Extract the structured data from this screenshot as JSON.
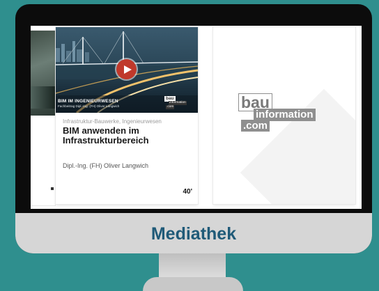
{
  "footer": {
    "title": "Mediathek"
  },
  "card": {
    "thumbnail": {
      "title": "BIM IM INGENIEURWESEN",
      "subtitle": "Fachbeitrag Dipl.-Ing. (FH) Oliver Langwich",
      "logo": {
        "line1": "bau",
        "line2": "information",
        "line3": ".com"
      },
      "play_icon": "play-icon"
    },
    "category": "Infrastruktur-Bauwerke, Ingenieurwesen",
    "title": "BIM anwenden im Infrastrukturbereich",
    "author": "Dipl.-Ing. (FH) Oliver Langwich",
    "duration": "40'"
  },
  "logo_card": {
    "line1": "bau",
    "line2": "information",
    "line3": ".com"
  },
  "colors": {
    "background": "#2f8f8e",
    "monitor_frame": "#0c0c0c",
    "chin": "#d6d6d6",
    "title_color": "#1f5a78",
    "play_button": "#c0392b"
  }
}
